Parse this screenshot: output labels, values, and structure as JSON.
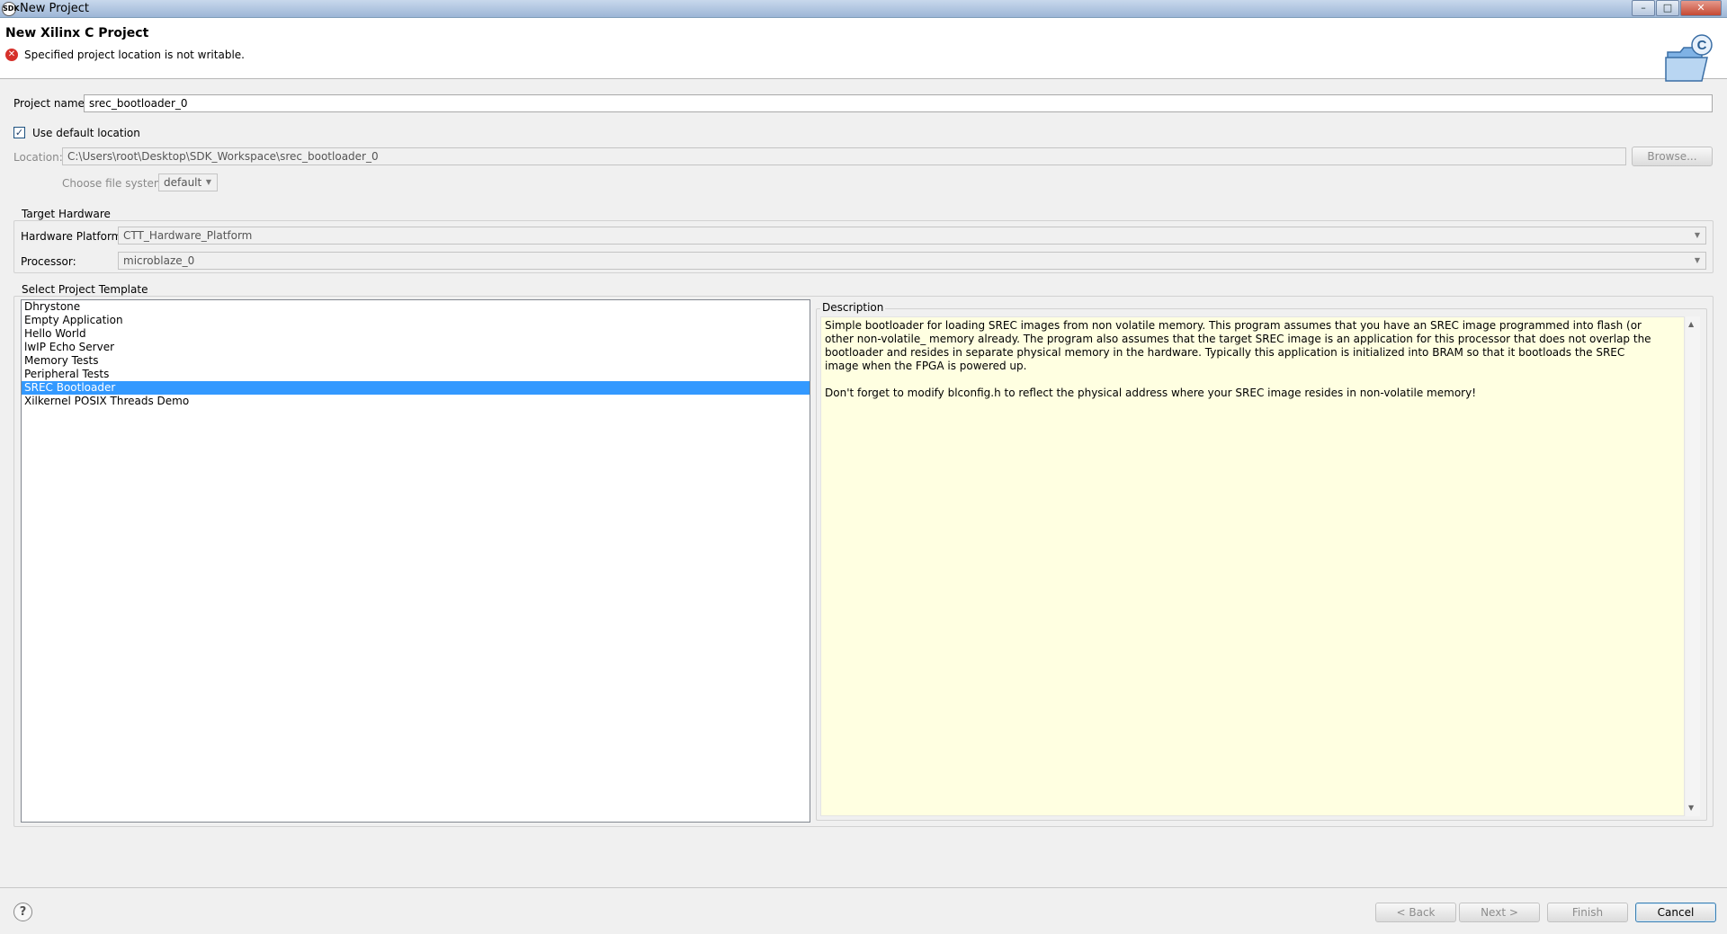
{
  "window": {
    "title": "New Project",
    "app_icon": "SDK",
    "min": "–",
    "max": "□",
    "close": "✕"
  },
  "header": {
    "title": "New Xilinx C Project",
    "error_icon": "✕",
    "error_message": "Specified project location is not writable."
  },
  "form": {
    "project_name_label": "Project name:",
    "project_name_value": "srec_bootloader_0",
    "use_default_location_label": "Use default location",
    "use_default_location_checked": true,
    "checkmark": "✓",
    "location_label": "Location:",
    "location_value": "C:\\Users\\root\\Desktop\\SDK_Workspace\\srec_bootloader_0",
    "browse_label": "Browse...",
    "file_system_label": "Choose file system:",
    "file_system_value": "default"
  },
  "target_hardware": {
    "group_label": "Target Hardware",
    "platform_label": "Hardware Platform:",
    "platform_value": "CTT_Hardware_Platform",
    "processor_label": "Processor:",
    "processor_value": "microblaze_0"
  },
  "templates": {
    "group_label": "Select Project Template",
    "items": [
      {
        "label": "Dhrystone",
        "selected": false
      },
      {
        "label": "Empty Application",
        "selected": false
      },
      {
        "label": "Hello World",
        "selected": false
      },
      {
        "label": "lwIP Echo Server",
        "selected": false
      },
      {
        "label": "Memory Tests",
        "selected": false
      },
      {
        "label": "Peripheral Tests",
        "selected": false
      },
      {
        "label": "SREC Bootloader",
        "selected": true
      },
      {
        "label": "Xilkernel POSIX Threads Demo",
        "selected": false
      }
    ]
  },
  "description": {
    "label": "Description",
    "text": "Simple bootloader for loading SREC images from non volatile memory. This program assumes that you have an SREC image programmed into flash (or other non-volatile_ memory already. The program also assumes that the target SREC image is an application for this processor that does not overlap the bootloader and resides in separate physical memory in the hardware. Typically this application is initialized into BRAM so that it bootloads the SREC image when the FPGA is powered up.\n\nDon't forget to modify blconfig.h to reflect the physical address where your SREC image resides in non-volatile memory!",
    "scroll_up": "▲",
    "scroll_down": "▼"
  },
  "footer": {
    "help": "?",
    "back_label": "< Back",
    "next_label": "Next >",
    "finish_label": "Finish",
    "cancel_label": "Cancel"
  },
  "colors": {
    "selection": "#3399ff",
    "description_bg": "#ffffe1",
    "error": "#d6312b"
  }
}
